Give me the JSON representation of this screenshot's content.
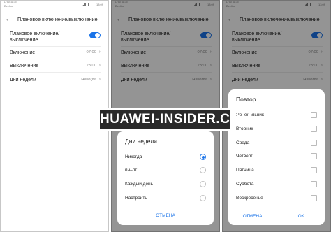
{
  "status_bar": {
    "carrier_line1": "MTS RUS",
    "carrier_line2": "Beeline",
    "time": "13:09"
  },
  "header": {
    "title": "Плановое включение/выключение"
  },
  "settings": {
    "toggle_line1": "Плановое включение/",
    "toggle_line2": "выключение",
    "toggle_on": true,
    "accent_color": "#1a73e8",
    "on_label": "Включение",
    "on_value": "07:00",
    "off_label": "Выключение",
    "off_value": "23:00",
    "days_label": "Дни недели",
    "days_value": "Никогда"
  },
  "days_dialog": {
    "title": "Дни недели",
    "options": [
      "Никогда",
      "пн–пт",
      "Каждый день",
      "Настроить"
    ],
    "selected_index": 0,
    "cancel_label": "ОТМЕНА"
  },
  "repeat_dialog": {
    "title": "Повтор",
    "days": [
      "Понедельник",
      "Вторник",
      "Среда",
      "Четверг",
      "Пятница",
      "Суббота",
      "Воскресенье"
    ],
    "cancel_label": "ОТМЕНА",
    "ok_label": "ОК"
  },
  "watermark": {
    "text": "HUAWEI-INSIDER.COM"
  }
}
